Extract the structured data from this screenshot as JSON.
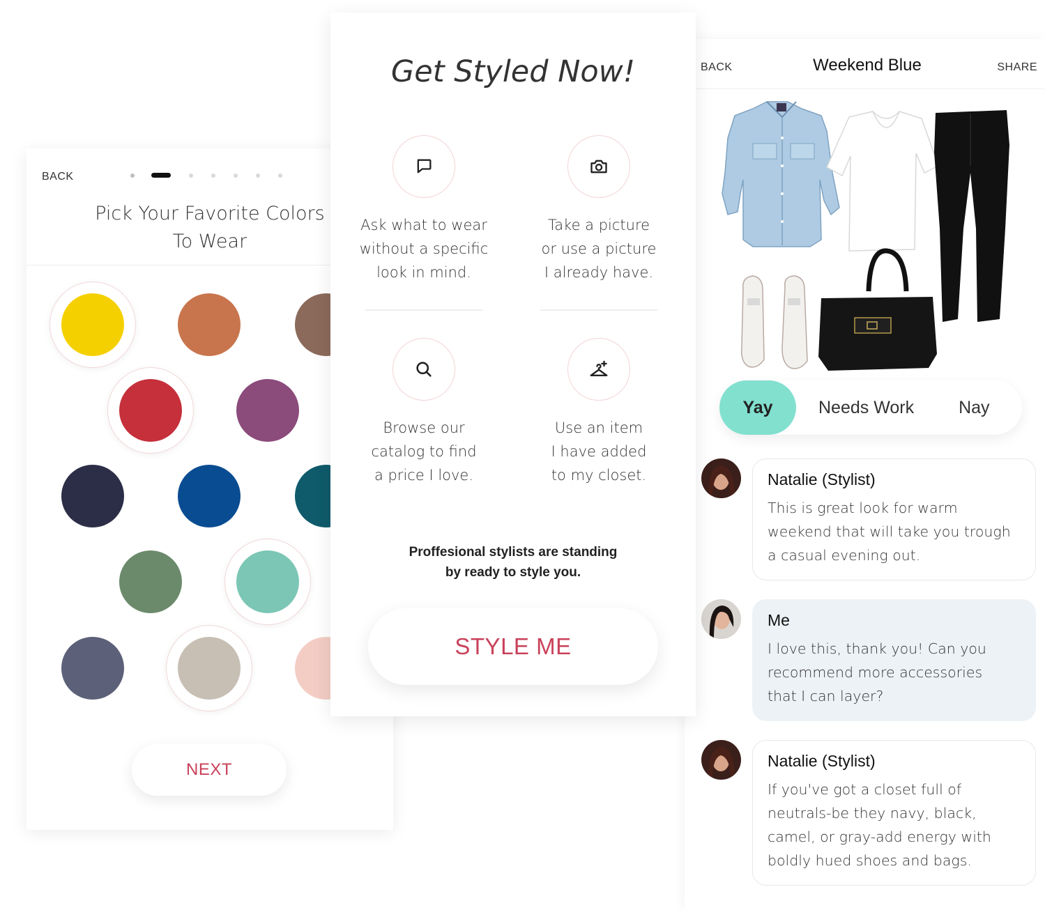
{
  "colors": {
    "accent": "#c9415a",
    "rating_selected": "#82e0cf",
    "my_bubble": "#edf2f6"
  },
  "color_picker": {
    "back_label": "BACK",
    "step_dots": 7,
    "active_step": 2,
    "title_line1": "Pick Your Favorite Colors",
    "title_line2": "To Wear",
    "swatches": [
      {
        "name": "yellow",
        "hex": "#f5d000",
        "selected": true
      },
      {
        "name": "copper",
        "hex": "#c8754d",
        "selected": false
      },
      {
        "name": "brown",
        "hex": "#8b6a5b",
        "selected": false
      },
      {
        "name": "red",
        "hex": "#c5303b",
        "selected": true
      },
      {
        "name": "purple",
        "hex": "#8b4b7b",
        "selected": false
      },
      {
        "name": "navy",
        "hex": "#2c2e47",
        "selected": false
      },
      {
        "name": "cobalt",
        "hex": "#0a4c91",
        "selected": false
      },
      {
        "name": "teal",
        "hex": "#0f5b6b",
        "selected": false
      },
      {
        "name": "sage",
        "hex": "#6b8a6b",
        "selected": false
      },
      {
        "name": "mint",
        "hex": "#7cc6b5",
        "selected": true
      },
      {
        "name": "slate",
        "hex": "#5c6078",
        "selected": false
      },
      {
        "name": "taupe",
        "hex": "#c8bfb4",
        "selected": true
      },
      {
        "name": "blush",
        "hex": "#f3cdc4",
        "selected": false
      }
    ],
    "next_label": "NEXT"
  },
  "get_styled": {
    "heading": "Get Styled Now!",
    "options": [
      {
        "icon": "chat-bubble-icon",
        "lines": [
          "Ask what to wear",
          "without a specific",
          "look in mind."
        ]
      },
      {
        "icon": "camera-icon",
        "lines": [
          "Take a picture",
          "or use a picture",
          "I already have."
        ]
      },
      {
        "icon": "search-icon",
        "lines": [
          "Browse our",
          "catalog to find",
          "a price I love."
        ]
      },
      {
        "icon": "hanger-add-icon",
        "lines": [
          "Use an item",
          "I have added",
          "to my closet."
        ]
      }
    ],
    "promo_line1": "Proffesional stylists are standing",
    "promo_line2": "by ready to style you.",
    "cta_label": "STYLE ME"
  },
  "outfit_view": {
    "back_label": "BACK",
    "title": "Weekend Blue",
    "share_label": "SHARE",
    "rating": {
      "options": [
        "Yay",
        "Needs Work",
        "Nay"
      ],
      "selected": "Yay"
    },
    "messages": [
      {
        "author": "Natalie (Stylist)",
        "text": "This is great look for warm weekend that will take you trough a casual evening out.",
        "lines": [
          "This is great look for warm",
          "weekend that will take you trough",
          "a casual evening out."
        ],
        "mine": false
      },
      {
        "author": "Me",
        "text": "I love this, thank you! Can you recommend more accessories that I can layer?",
        "lines": [
          "I love this, thank you! Can you",
          "recommend more accessories",
          "that I can layer?"
        ],
        "mine": true
      },
      {
        "author": "Natalie (Stylist)",
        "text": "If you've got a closet full of neutrals-be they navy, black, camel, or gray-add energy with boldly hued shoes and bags.",
        "lines": [
          "If you've got a closet full of",
          "neutrals-be they navy, black,",
          "camel, or gray-add energy with",
          "boldly hued shoes and bags."
        ],
        "mine": false
      }
    ]
  }
}
